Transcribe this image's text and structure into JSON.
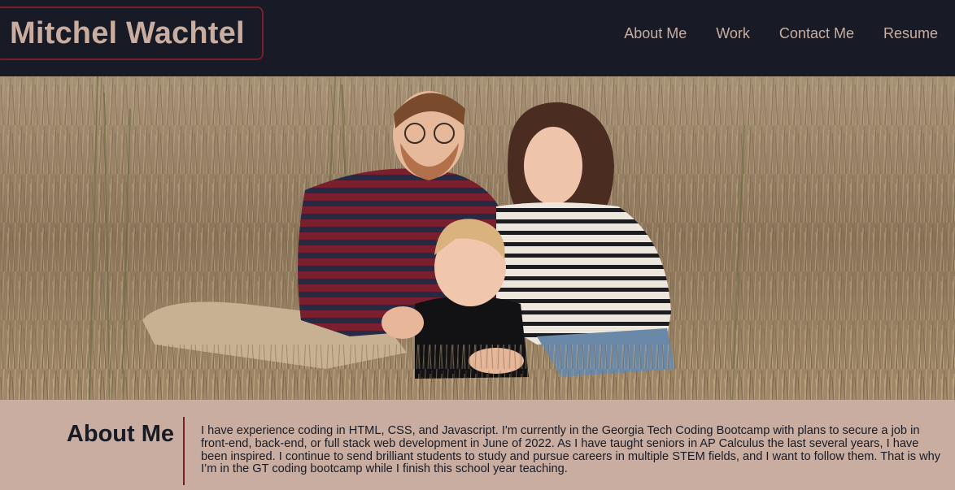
{
  "header": {
    "brand": "Mitchel Wachtel",
    "nav": [
      {
        "label": "About Me"
      },
      {
        "label": "Work"
      },
      {
        "label": "Contact Me"
      },
      {
        "label": "Resume"
      }
    ]
  },
  "hero": {
    "image_alt": "family-photo"
  },
  "about": {
    "title": "About Me",
    "text": "I have experience coding in HTML, CSS, and Javascript. I'm currently in the Georgia Tech Coding Bootcamp with plans to secure a job in front-end, back-end, or full stack web development in June of 2022. As I have taught seniors in AP Calculus the last several years, I have been inspired. I continue to send brilliant students to study and pursue careers in multiple STEM fields, and I want to follow them. That is why I’m in the GT coding bootcamp while I finish this school year teaching."
  },
  "colors": {
    "header_bg": "#181b25",
    "accent_tan": "#c9ada0",
    "accent_maroon": "#7a1f2a"
  }
}
